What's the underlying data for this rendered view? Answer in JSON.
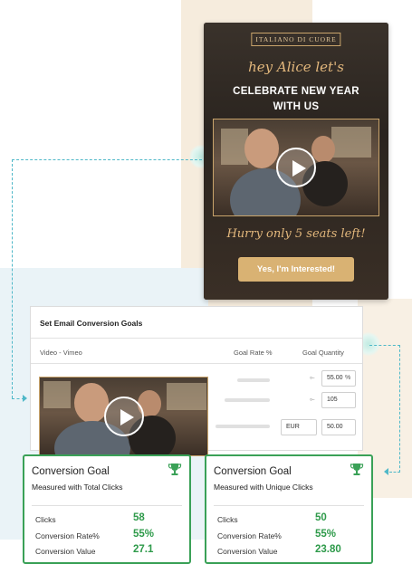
{
  "email": {
    "brand": "ITALIANO DI CUORE",
    "greeting": "hey Alice let's",
    "headline_line1": "CELEBRATE NEW YEAR",
    "headline_line2": "WITH US",
    "hurry": "Hurry only 5 seats left!",
    "cta_label": "Yes, I'm Interested!",
    "accent": "#d9b273"
  },
  "goals_panel": {
    "title": "Set Email Conversion Goals",
    "columns": [
      "Video - Vimeo",
      "Goal Rate %",
      "Goal Quantity"
    ],
    "rows": [
      {
        "value": "55.00",
        "unit": "%"
      },
      {
        "value": "105"
      },
      {
        "currency": "EUR",
        "value": "50.00"
      }
    ]
  },
  "cards": [
    {
      "title": "Conversion Goal",
      "subtitle": "Measured with Total Clicks",
      "metrics": [
        {
          "label": "Clicks",
          "value": "58"
        },
        {
          "label": "Conversion Rate%",
          "value": "55%"
        },
        {
          "label": "Conversion Value",
          "value": "27.1"
        }
      ]
    },
    {
      "title": "Conversion Goal",
      "subtitle": "Measured with Unique Clicks",
      "metrics": [
        {
          "label": "Clicks",
          "value": "50"
        },
        {
          "label": "Conversion Rate%",
          "value": "55%"
        },
        {
          "label": "Conversion Value",
          "value": "23.80"
        }
      ]
    }
  ],
  "colors": {
    "success": "#2e9a4a",
    "border": "#3aa157",
    "connector": "#4fb8c8"
  },
  "icons": [
    "play-icon",
    "trophy-icon",
    "link-icon"
  ]
}
